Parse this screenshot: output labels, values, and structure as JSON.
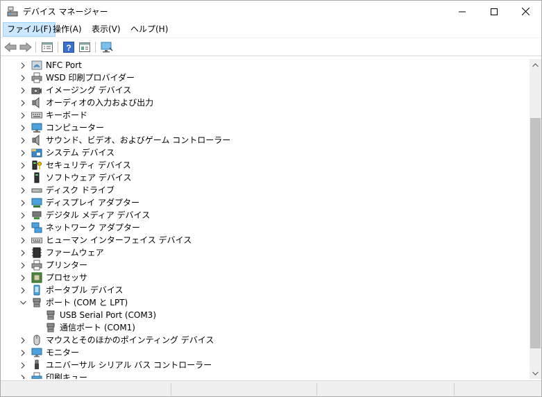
{
  "window": {
    "title": "デバイス マネージャー"
  },
  "menu": {
    "file": "ファイル(F)",
    "action": "操作(A)",
    "view": "表示(V)",
    "help": "ヘルプ(H)"
  },
  "toolbar": {
    "buttons": [
      "back-icon",
      "forward-icon",
      "properties-icon",
      "help-icon",
      "view-icon",
      "scan-hardware-icon"
    ]
  },
  "tree": {
    "items": [
      {
        "label": "NFC Port",
        "expanded": false,
        "icon": "nfc-icon"
      },
      {
        "label": "WSD 印刷プロバイダー",
        "expanded": false,
        "icon": "printer-icon"
      },
      {
        "label": "イメージング デバイス",
        "expanded": false,
        "icon": "camera-icon"
      },
      {
        "label": "オーディオの入力および出力",
        "expanded": false,
        "icon": "speaker-icon"
      },
      {
        "label": "キーボード",
        "expanded": false,
        "icon": "keyboard-icon"
      },
      {
        "label": "コンピューター",
        "expanded": false,
        "icon": "computer-icon"
      },
      {
        "label": "サウンド、ビデオ、およびゲーム コントローラー",
        "expanded": false,
        "icon": "speaker-icon"
      },
      {
        "label": "システム デバイス",
        "expanded": false,
        "icon": "system-folder-icon"
      },
      {
        "label": "セキュリティ デバイス",
        "expanded": false,
        "icon": "security-key-icon"
      },
      {
        "label": "ソフトウェア デバイス",
        "expanded": false,
        "icon": "software-device-icon"
      },
      {
        "label": "ディスク ドライブ",
        "expanded": false,
        "icon": "disk-drive-icon"
      },
      {
        "label": "ディスプレイ アダプター",
        "expanded": false,
        "icon": "display-adapter-icon"
      },
      {
        "label": "デジタル メディア デバイス",
        "expanded": false,
        "icon": "media-device-icon"
      },
      {
        "label": "ネットワーク アダプター",
        "expanded": false,
        "icon": "network-adapter-icon"
      },
      {
        "label": "ヒューマン インターフェイス デバイス",
        "expanded": false,
        "icon": "hid-icon"
      },
      {
        "label": "ファームウェア",
        "expanded": false,
        "icon": "firmware-chip-icon"
      },
      {
        "label": "プリンター",
        "expanded": false,
        "icon": "printer-icon"
      },
      {
        "label": "プロセッサ",
        "expanded": false,
        "icon": "processor-icon"
      },
      {
        "label": "ポータブル デバイス",
        "expanded": false,
        "icon": "portable-device-icon"
      },
      {
        "label": "ポート (COM と LPT)",
        "expanded": true,
        "icon": "port-icon"
      },
      {
        "label": "USB Serial Port (COM3)",
        "child": true,
        "icon": "port-icon"
      },
      {
        "label": "通信ポート (COM1)",
        "child": true,
        "icon": "port-icon"
      },
      {
        "label": "マウスとそのほかのポインティング デバイス",
        "expanded": false,
        "icon": "mouse-icon"
      },
      {
        "label": "モニター",
        "expanded": false,
        "icon": "monitor-icon"
      },
      {
        "label": "ユニバーサル シリアル バス コントローラー",
        "expanded": false,
        "icon": "usb-icon"
      },
      {
        "label": "印刷キュー",
        "expanded": false,
        "icon": "print-queue-icon"
      }
    ]
  }
}
